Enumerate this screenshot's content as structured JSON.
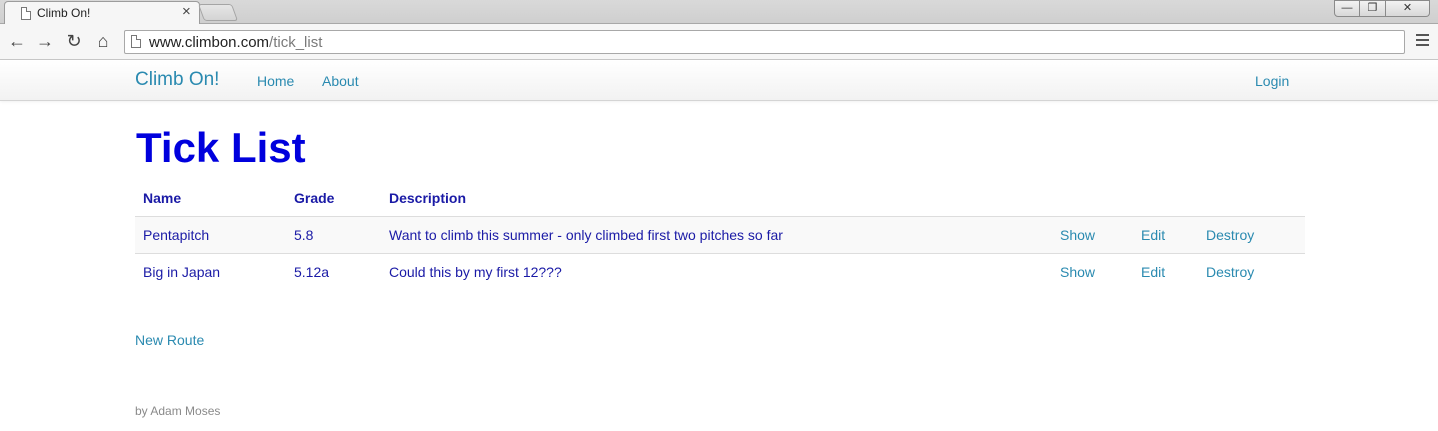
{
  "browser": {
    "tab_title": "Climb On!",
    "tab_close": "×",
    "url_host": "www.climbon.com",
    "url_path": "/tick_list",
    "controls": {
      "minimize": "—",
      "maximize": "❐",
      "close": "✕"
    },
    "nav": {
      "back": "←",
      "forward": "→",
      "reload": "↻",
      "home": "⌂"
    }
  },
  "navbar": {
    "brand": "Climb On!",
    "links": {
      "home": "Home",
      "about": "About",
      "login": "Login"
    }
  },
  "page": {
    "title": "Tick List",
    "table": {
      "headers": {
        "name": "Name",
        "grade": "Grade",
        "description": "Description"
      },
      "rows": [
        {
          "name": "Pentapitch",
          "grade": "5.8",
          "description": "Want to climb this summer - only climbed first two pitches so far",
          "show": "Show",
          "edit": "Edit",
          "destroy": "Destroy"
        },
        {
          "name": "Big in Japan",
          "grade": "5.12a",
          "description": "Could this by my first 12???",
          "show": "Show",
          "edit": "Edit",
          "destroy": "Destroy"
        }
      ]
    },
    "new_route": "New Route",
    "footer": "by Adam Moses"
  },
  "colors": {
    "link": "#2a8ab0",
    "title": "#0000dd",
    "table_text": "#1a1aa6",
    "footer": "#8a8a8a"
  }
}
